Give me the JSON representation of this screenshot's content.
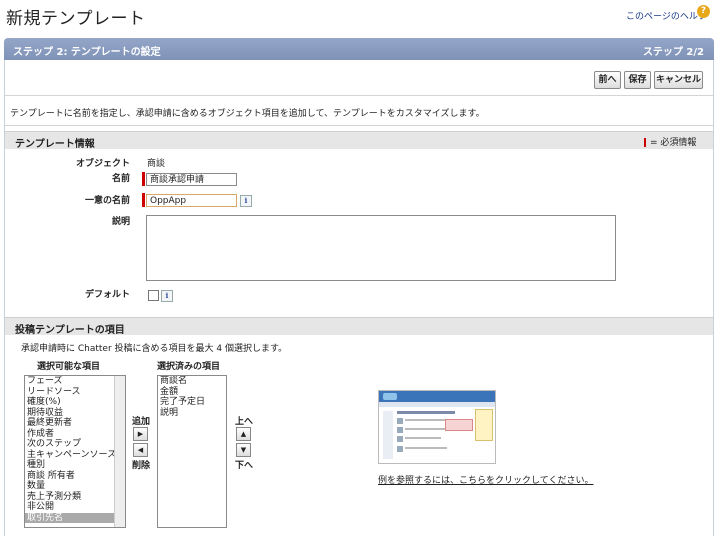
{
  "header": {
    "title": "新規テンプレート",
    "help_link": "このページのヘルプ",
    "help_icon": "question-icon"
  },
  "step_bar": {
    "title": "ステップ 2: テンプレートの設定",
    "counter": "ステップ 2/2"
  },
  "toolbar": {
    "prev_label": "前へ",
    "save_label": "保存",
    "cancel_label": "キャンセル"
  },
  "description": "テンプレートに名前を指定し、承認申請に含めるオブジェクト項目を追加して、テンプレートをカスタマイズします。",
  "template_info": {
    "section_title": "テンプレート情報",
    "required_note": "= 必須情報",
    "object_label": "オブジェクト",
    "object_value": "商談",
    "name_label": "名前",
    "name_value": "商談承認申請",
    "unique_name_label": "一意の名前",
    "unique_name_value": "OppApp",
    "description_label": "説明",
    "description_value": "",
    "default_label": "デフォルト",
    "default_checked": false
  },
  "post_template": {
    "section_title": "投稿テンプレートの項目",
    "instruction": "承認申請時に Chatter 投稿に含める項目を最大 4 個選択します。",
    "available_header": "選択可能な項目",
    "selected_header": "選択済みの項目",
    "available_items": [
      "フェーズ",
      "リードソース",
      "確度(%)",
      "期待収益",
      "最終更新者",
      "作成者",
      "次のステップ",
      "主キャンペーンソース",
      "種別",
      "商談 所有者",
      "数量",
      "売上予測分類",
      "非公開",
      "取引先名"
    ],
    "available_selected_index": 13,
    "selected_items": [
      "商談名",
      "金額",
      "完了予定日",
      "説明"
    ],
    "add_label": "追加",
    "remove_label": "削除",
    "up_label": "上へ",
    "down_label": "下へ",
    "example_link": "例を参照するには、こちらをクリックしてください。"
  }
}
